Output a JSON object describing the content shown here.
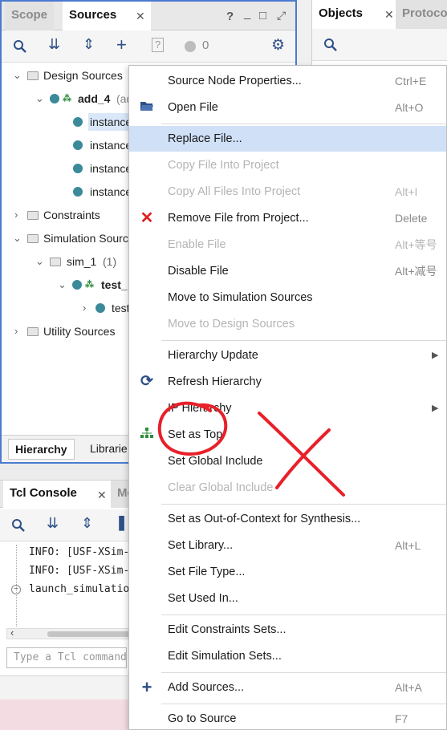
{
  "sources": {
    "tabs": [
      {
        "label": "Scope",
        "active": false
      },
      {
        "label": "Sources",
        "active": true
      }
    ],
    "window_controls": [
      "?",
      "_",
      "□",
      "⤢"
    ],
    "toolbar_count": "0",
    "tree": {
      "design_sources": "Design Sources",
      "add_4": "add_4",
      "add_4_suffix": "(ad",
      "instance_1": "instance",
      "instance_2": "instance",
      "instance_3": "instance",
      "instance_4": "instance",
      "constraints": "Constraints",
      "simulation_sources": "Simulation Sourc",
      "sim_1": "sim_1",
      "sim_1_count": "(1)",
      "test": "test_",
      "test_child": "test",
      "utility_sources": "Utility Sources"
    },
    "bottom_tabs": [
      "Hierarchy",
      "Librarie"
    ]
  },
  "objects": {
    "tabs": [
      "Objects",
      "Protoco"
    ]
  },
  "tcl": {
    "tabs": [
      "Tcl Console",
      "Me"
    ],
    "lines": [
      "INFO: [USF-XSim-",
      "INFO: [USF-XSim-",
      "launch_simulatio"
    ],
    "input_placeholder": "Type a Tcl command"
  },
  "menu": {
    "items": [
      {
        "label": "Source Node Properties...",
        "shortcut": "Ctrl+E",
        "disabled": false
      },
      {
        "label": "Open File",
        "shortcut": "Alt+O",
        "disabled": false,
        "icon": "open-folder-icon"
      },
      {
        "label": "Replace File...",
        "shortcut": "",
        "disabled": false,
        "highlight": true
      },
      {
        "label": "Copy File Into Project",
        "shortcut": "",
        "disabled": true
      },
      {
        "label": "Copy All Files Into Project",
        "shortcut": "Alt+I",
        "disabled": true
      },
      {
        "label": "Remove File from Project...",
        "shortcut": "Delete",
        "disabled": false,
        "icon": "red-x-icon"
      },
      {
        "label": "Enable File",
        "shortcut": "Alt+等号",
        "disabled": true
      },
      {
        "label": "Disable File",
        "shortcut": "Alt+减号",
        "disabled": false
      },
      {
        "label": "Move to Simulation Sources",
        "shortcut": "",
        "disabled": false
      },
      {
        "label": "Move to Design Sources",
        "shortcut": "",
        "disabled": true
      },
      {
        "label": "Hierarchy Update",
        "shortcut": "",
        "disabled": false,
        "submenu": true
      },
      {
        "label": "Refresh Hierarchy",
        "shortcut": "",
        "disabled": false,
        "icon": "refresh-icon"
      },
      {
        "label": "IP Hierarchy",
        "shortcut": "",
        "disabled": false,
        "submenu": true
      },
      {
        "label": "Set as Top",
        "shortcut": "",
        "disabled": false,
        "icon": "hierarchy-icon"
      },
      {
        "label": "Set Global Include",
        "shortcut": "",
        "disabled": false
      },
      {
        "label": "Clear Global Include",
        "shortcut": "",
        "disabled": true
      },
      {
        "label": "Set as Out-of-Context for Synthesis...",
        "shortcut": "",
        "disabled": false
      },
      {
        "label": "Set Library...",
        "shortcut": "Alt+L",
        "disabled": false
      },
      {
        "label": "Set File Type...",
        "shortcut": "",
        "disabled": false
      },
      {
        "label": "Set Used In...",
        "shortcut": "",
        "disabled": false
      },
      {
        "label": "Edit Constraints Sets...",
        "shortcut": "",
        "disabled": false
      },
      {
        "label": "Edit Simulation Sets...",
        "shortcut": "",
        "disabled": false
      },
      {
        "label": "Add Sources...",
        "shortcut": "Alt+A",
        "disabled": false,
        "icon": "plus-icon"
      },
      {
        "label": "Go to Source",
        "shortcut": "F7",
        "disabled": false
      }
    ]
  },
  "colors": {
    "accent": "#4a7bd0",
    "highlight": "#cfe0f7",
    "annotation_red": "#e8202a"
  }
}
